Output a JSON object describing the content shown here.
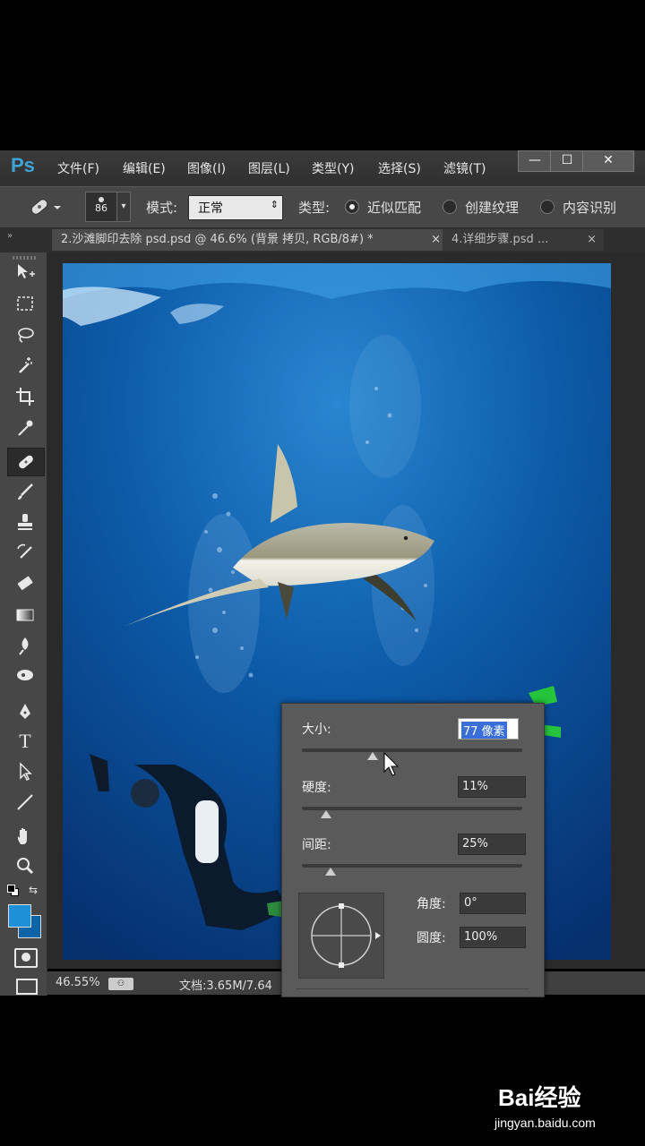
{
  "app": {
    "logo": "Ps"
  },
  "menu": [
    "文件(F)",
    "编辑(E)",
    "图像(I)",
    "图层(L)",
    "类型(Y)",
    "选择(S)",
    "滤镜(T)"
  ],
  "window_controls": {
    "minimize": "—",
    "maximize": "☐",
    "close": "✕"
  },
  "options": {
    "brush_size": "86",
    "mode_label": "模式:",
    "mode_value": "正常",
    "type_label": "类型:",
    "type_options": [
      "近似匹配",
      "创建纹理",
      "内容识别"
    ],
    "type_selected_index": 0
  },
  "tabs": [
    {
      "label": "2.沙滩脚印去除 psd.psd @ 46.6% (背景 拷贝, RGB/8#) *",
      "close": "×",
      "active": true
    },
    {
      "label": "4.详细步骤.psd ...",
      "close": "×",
      "active": false
    }
  ],
  "toolbar_icons": [
    "move-icon",
    "marquee-icon",
    "lasso-icon",
    "magic-wand-icon",
    "crop-icon",
    "eyedropper-icon",
    "spot-healing-icon",
    "brush-icon",
    "stamp-icon",
    "history-brush-icon",
    "eraser-icon",
    "gradient-icon",
    "blur-icon",
    "dodge-icon",
    "pen-icon",
    "type-icon",
    "path-select-icon",
    "line-icon",
    "hand-icon",
    "zoom-icon"
  ],
  "status": {
    "zoom": "46.55%",
    "doc": "文档:3.65M/7.64"
  },
  "brush_popup": {
    "size_label": "大小:",
    "size_value": "77 像素",
    "size_fraction": 0.32,
    "hardness_label": "硬度:",
    "hardness_value": "11%",
    "hardness_fraction": 0.11,
    "spacing_label": "间距:",
    "spacing_value": "25%",
    "spacing_fraction": 0.13,
    "angle_label": "角度:",
    "angle_value": "0°",
    "roundness_label": "圆度:",
    "roundness_value": "100%"
  },
  "watermark": {
    "logo": "Bai经验",
    "url": "jingyan.baidu.com"
  },
  "colors": {
    "foreground": "#1e8fd9",
    "background": "#0b63a8",
    "accent": "#3fa3d6"
  }
}
